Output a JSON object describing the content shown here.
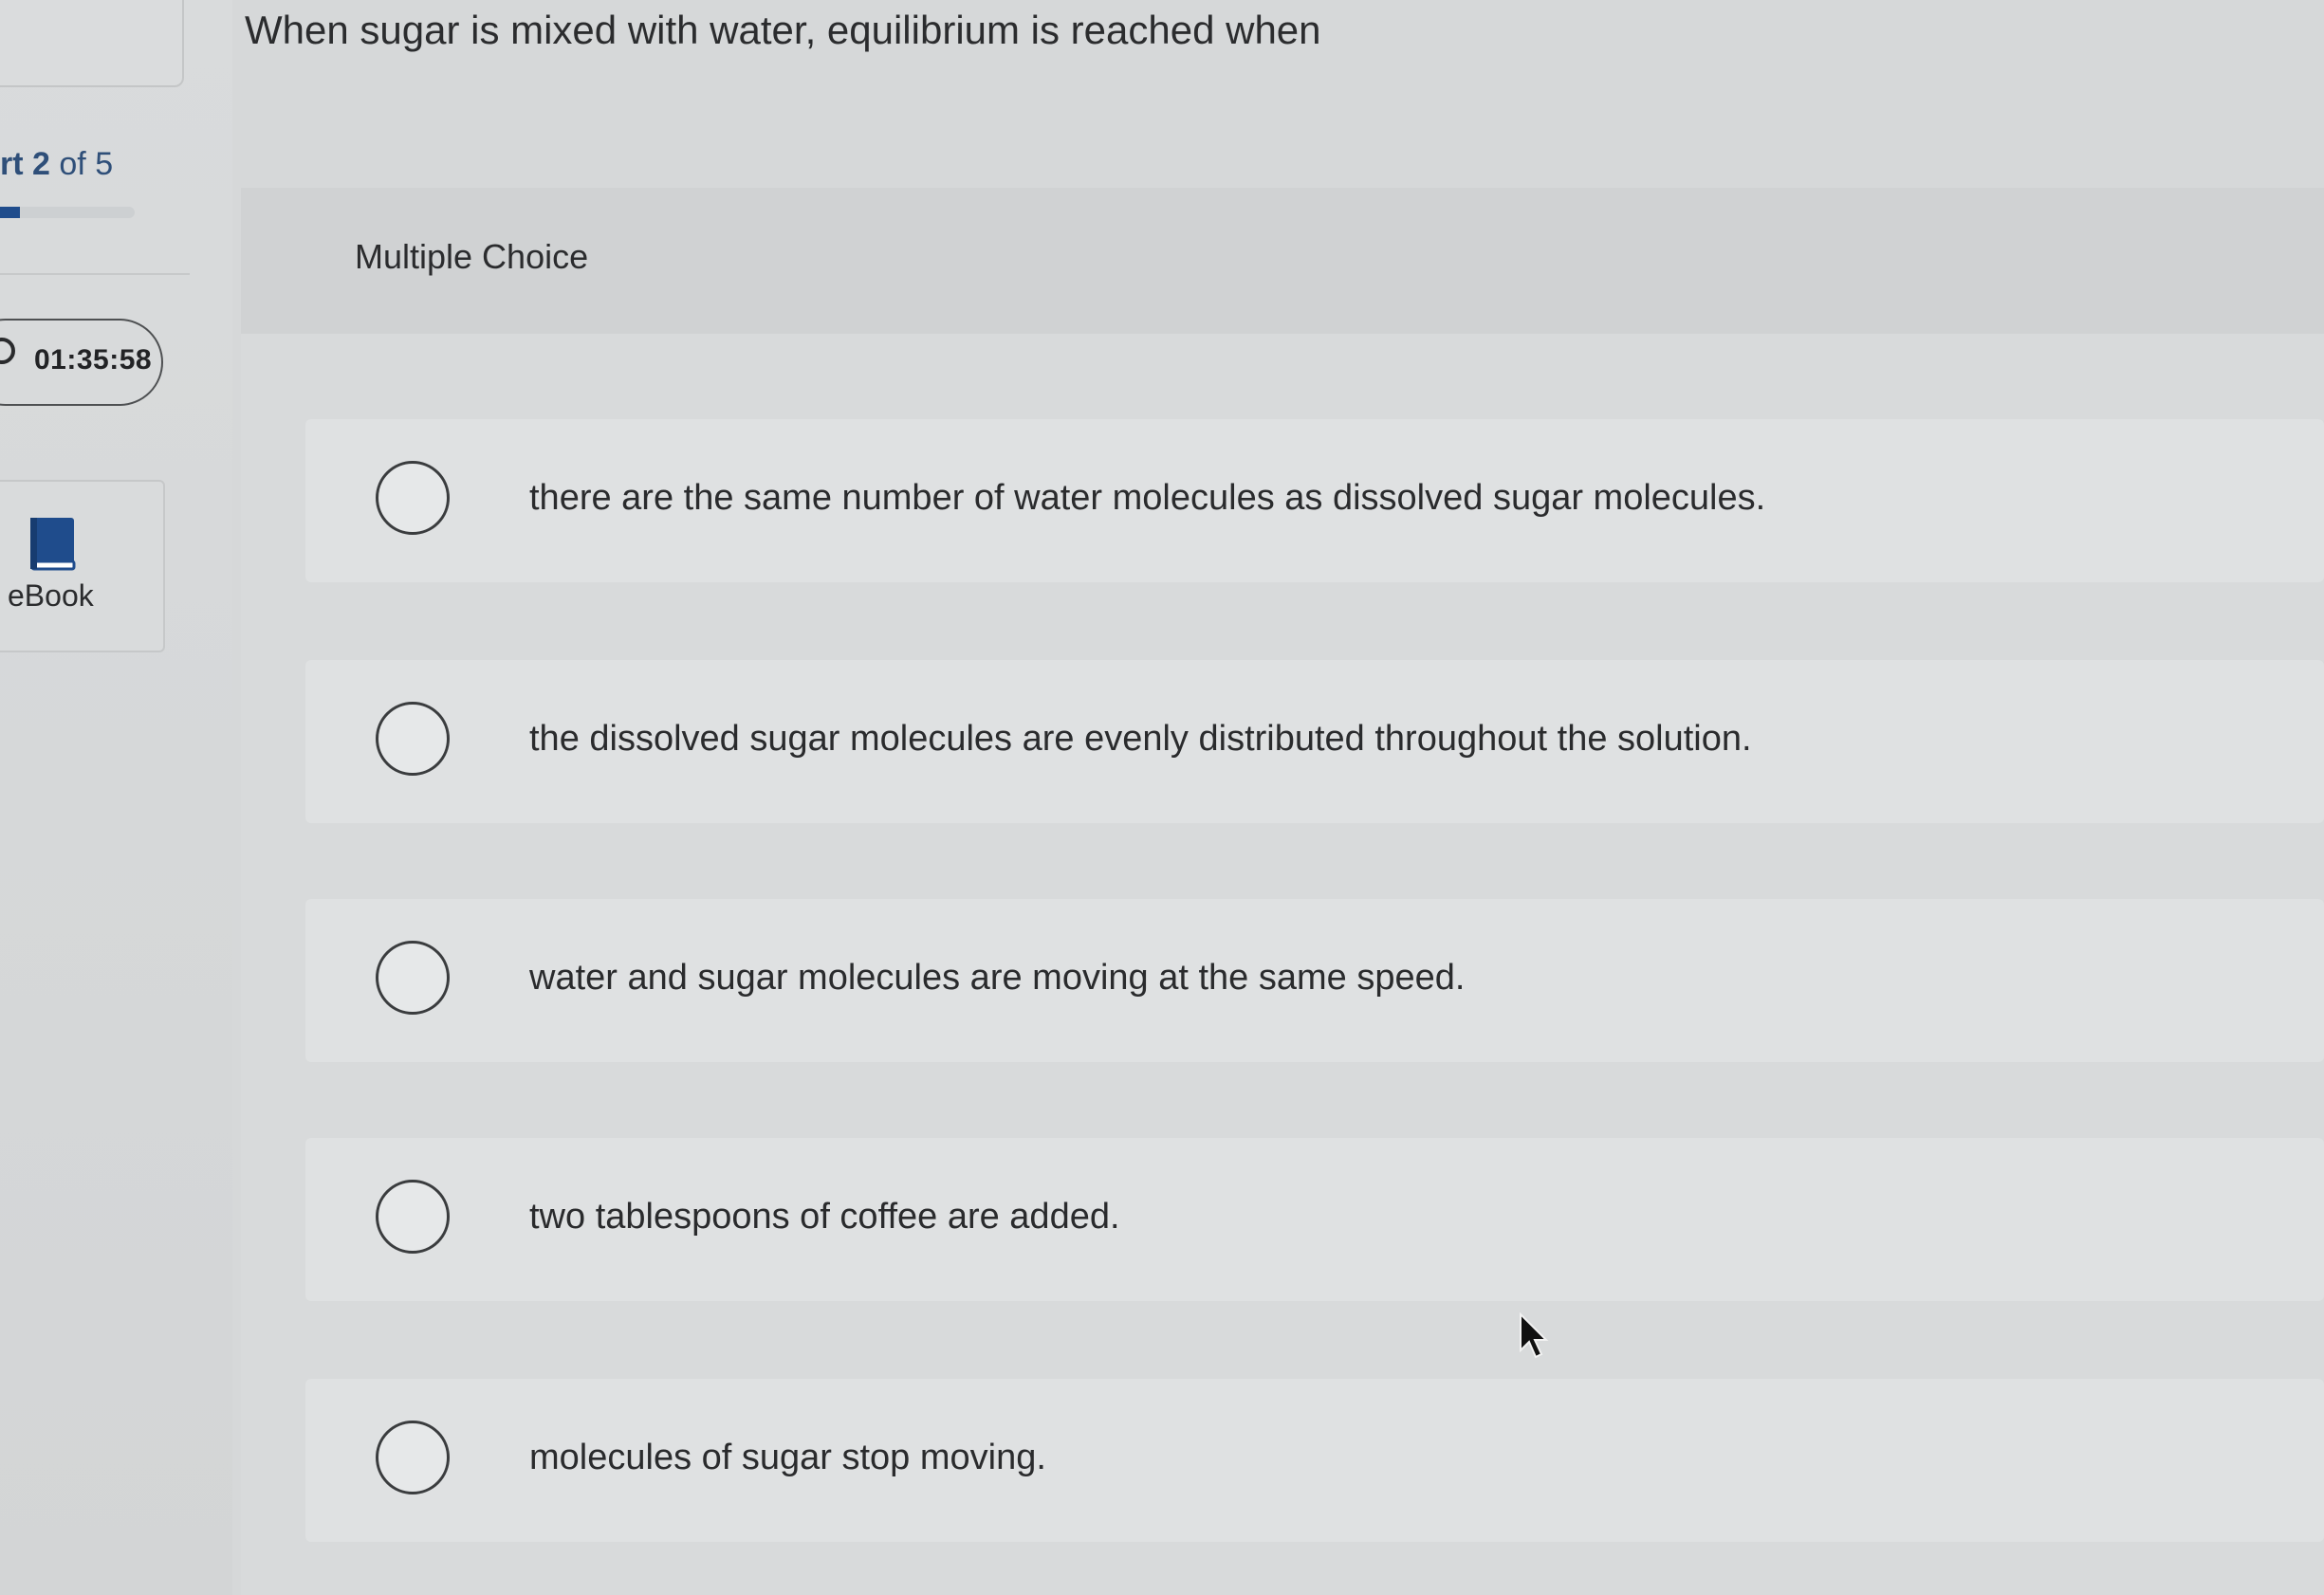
{
  "sidebar": {
    "part": {
      "prefix": "rt",
      "current": "2",
      "separator": "of",
      "total": "5"
    },
    "progress_fraction": 0.15,
    "timer": "01:35:58",
    "ebook_label": "eBook"
  },
  "question": "When sugar is mixed with water, equilibrium is reached when",
  "question_type": "Multiple Choice",
  "options": [
    "there are the same number of water molecules as dissolved sugar molecules.",
    "the dissolved sugar molecules are evenly distributed throughout the solution.",
    "water and sugar molecules are moving at the same speed.",
    "two tablespoons of coffee are added.",
    "molecules of sugar stop moving."
  ],
  "colors": {
    "accent": "#1f4c8c",
    "part_text": "#2f4f79"
  }
}
